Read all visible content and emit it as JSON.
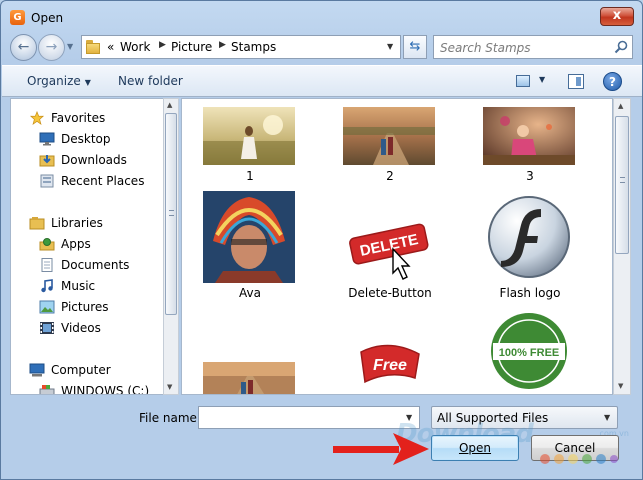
{
  "window": {
    "title": "Open",
    "app_icon_letter": "G",
    "close_label": "x"
  },
  "address_bar": {
    "chevron": "«",
    "path": [
      "Work",
      "Picture",
      "Stamps"
    ]
  },
  "search": {
    "placeholder": "Search Stamps"
  },
  "toolbar": {
    "organize": "Organize",
    "new_folder": "New folder",
    "help": "?"
  },
  "nav_pane": {
    "items": [
      {
        "label": "Favorites",
        "icon": "star-icon",
        "group": true
      },
      {
        "label": "Desktop",
        "icon": "desktop-icon"
      },
      {
        "label": "Downloads",
        "icon": "downloads-folder-icon"
      },
      {
        "label": "Recent Places",
        "icon": "recent-places-icon"
      },
      {
        "label": "Libraries",
        "icon": "libraries-icon",
        "group": true
      },
      {
        "label": "Apps",
        "icon": "apps-icon"
      },
      {
        "label": "Documents",
        "icon": "documents-icon"
      },
      {
        "label": "Music",
        "icon": "music-icon"
      },
      {
        "label": "Pictures",
        "icon": "pictures-icon"
      },
      {
        "label": "Videos",
        "icon": "videos-icon"
      },
      {
        "label": "Computer",
        "icon": "computer-icon",
        "group": true
      },
      {
        "label": "WINDOWS (C:)",
        "icon": "drive-icon"
      }
    ]
  },
  "files": [
    {
      "name": "1",
      "kind": "photo-field-woman"
    },
    {
      "name": "2",
      "kind": "photo-road-kids"
    },
    {
      "name": "3",
      "kind": "photo-girl-garden"
    },
    {
      "name": "Ava",
      "kind": "photo-headdress"
    },
    {
      "name": "Delete-Button",
      "kind": "stamp-delete"
    },
    {
      "name": "Flash logo",
      "kind": "logo-flash"
    },
    {
      "name": "",
      "kind": "photo-road-kids-2"
    },
    {
      "name": "",
      "kind": "stamp-free"
    },
    {
      "name": "",
      "kind": "stamp-100-free"
    }
  ],
  "stamp_text": {
    "delete": "DELETE",
    "free": "Free",
    "hundred_free": "100% FREE"
  },
  "bottom": {
    "file_name_label": "File name:",
    "file_name_value": "",
    "file_type": "All Supported Files",
    "open": "Open",
    "cancel": "Cancel"
  },
  "watermark": {
    "text": "Download",
    "suffix": ".com.vn"
  },
  "colors": {
    "accent_arrow": "#e3211c",
    "window_frame": "#b5cde9",
    "open_button_border": "#3c7fb1"
  }
}
